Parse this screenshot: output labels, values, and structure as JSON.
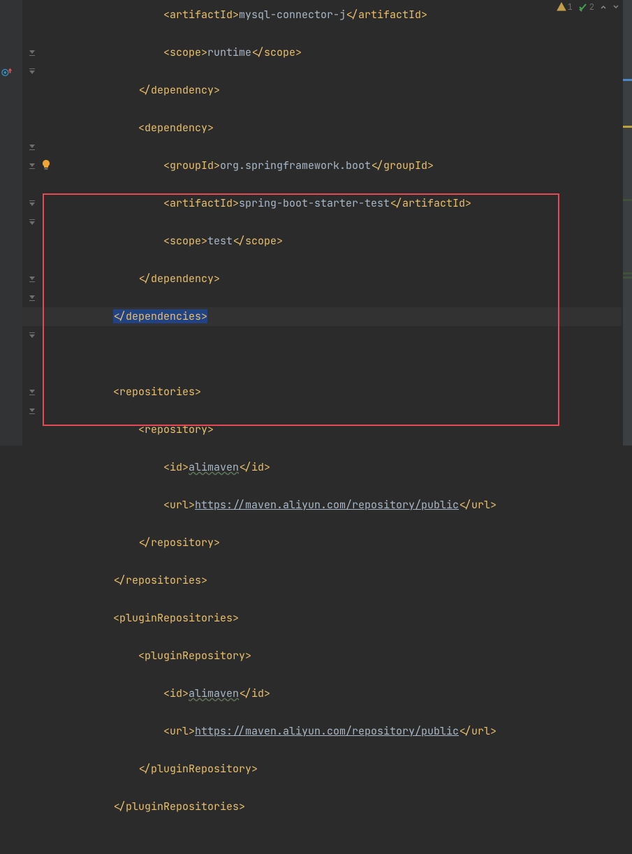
{
  "status": {
    "warnings": "1",
    "checks": "2"
  },
  "lines": [
    {
      "indent": 4,
      "parts": [
        {
          "t": "tag",
          "v": "<artifactId>"
        },
        {
          "t": "text",
          "v": "mysql-connector-j"
        },
        {
          "t": "tag",
          "v": "</artifactId>"
        }
      ]
    },
    {
      "indent": 4,
      "parts": [
        {
          "t": "tag",
          "v": "<scope>"
        },
        {
          "t": "text",
          "v": "runtime"
        },
        {
          "t": "tag",
          "v": "</scope>"
        }
      ]
    },
    {
      "indent": 3,
      "parts": [
        {
          "t": "tag",
          "v": "</dependency>"
        }
      ]
    },
    {
      "indent": 3,
      "parts": [
        {
          "t": "tag",
          "v": "<dependency>"
        }
      ]
    },
    {
      "indent": 4,
      "parts": [
        {
          "t": "tag",
          "v": "<groupId>"
        },
        {
          "t": "text",
          "v": "org.springframework.boot"
        },
        {
          "t": "tag",
          "v": "</groupId>"
        }
      ]
    },
    {
      "indent": 4,
      "parts": [
        {
          "t": "tag",
          "v": "<artifactId>"
        },
        {
          "t": "text",
          "v": "spring-boot-starter-test"
        },
        {
          "t": "tag",
          "v": "</artifactId>"
        }
      ]
    },
    {
      "indent": 4,
      "parts": [
        {
          "t": "tag",
          "v": "<scope>"
        },
        {
          "t": "text",
          "v": "test"
        },
        {
          "t": "tag",
          "v": "</scope>"
        }
      ]
    },
    {
      "indent": 3,
      "parts": [
        {
          "t": "tag",
          "v": "</dependency>"
        }
      ]
    },
    {
      "indent": 2,
      "highlighted": true,
      "selected": true,
      "parts": [
        {
          "t": "tag",
          "v": "</dependencies>"
        }
      ]
    },
    {
      "indent": 0,
      "parts": []
    },
    {
      "indent": 2,
      "parts": [
        {
          "t": "tag",
          "v": "<repositories>"
        }
      ]
    },
    {
      "indent": 3,
      "parts": [
        {
          "t": "tag",
          "v": "<repository>"
        }
      ]
    },
    {
      "indent": 4,
      "parts": [
        {
          "t": "tag",
          "v": "<id>"
        },
        {
          "t": "spell",
          "v": "alimaven"
        },
        {
          "t": "tag",
          "v": "</id>"
        }
      ]
    },
    {
      "indent": 4,
      "parts": [
        {
          "t": "tag",
          "v": "<url>"
        },
        {
          "t": "url",
          "v": "https://maven.aliyun.com/repository/public"
        },
        {
          "t": "tag",
          "v": "</url>"
        }
      ]
    },
    {
      "indent": 3,
      "parts": [
        {
          "t": "tag",
          "v": "</repository>"
        }
      ]
    },
    {
      "indent": 2,
      "parts": [
        {
          "t": "tag",
          "v": "</repositories>"
        }
      ]
    },
    {
      "indent": 2,
      "parts": [
        {
          "t": "tag",
          "v": "<pluginRepositories>"
        }
      ]
    },
    {
      "indent": 3,
      "parts": [
        {
          "t": "tag",
          "v": "<pluginRepository>"
        }
      ]
    },
    {
      "indent": 4,
      "parts": [
        {
          "t": "tag",
          "v": "<id>"
        },
        {
          "t": "spell",
          "v": "alimaven"
        },
        {
          "t": "tag",
          "v": "</id>"
        }
      ]
    },
    {
      "indent": 4,
      "parts": [
        {
          "t": "tag",
          "v": "<url>"
        },
        {
          "t": "url",
          "v": "https://maven.aliyun.com/repository/public"
        },
        {
          "t": "tag",
          "v": "</url>"
        }
      ]
    },
    {
      "indent": 3,
      "parts": [
        {
          "t": "tag",
          "v": "</pluginRepository>"
        }
      ]
    },
    {
      "indent": 2,
      "parts": [
        {
          "t": "tag",
          "v": "</pluginRepositories>"
        }
      ]
    },
    {
      "indent": 0,
      "parts": []
    }
  ],
  "gutterMarks": [
    {
      "row": 2,
      "type": "fold-up"
    },
    {
      "row": 3,
      "type": "fold-down"
    },
    {
      "row": 3,
      "type": "run"
    },
    {
      "row": 7,
      "type": "fold-up"
    },
    {
      "row": 8,
      "type": "fold-up"
    },
    {
      "row": 10,
      "type": "fold-down"
    },
    {
      "row": 11,
      "type": "fold-down"
    },
    {
      "row": 14,
      "type": "fold-up"
    },
    {
      "row": 15,
      "type": "fold-up"
    },
    {
      "row": 16,
      "type": "fold-down"
    },
    {
      "row": 17,
      "type": "fold-down"
    },
    {
      "row": 20,
      "type": "fold-up"
    },
    {
      "row": 21,
      "type": "fold-up"
    }
  ]
}
